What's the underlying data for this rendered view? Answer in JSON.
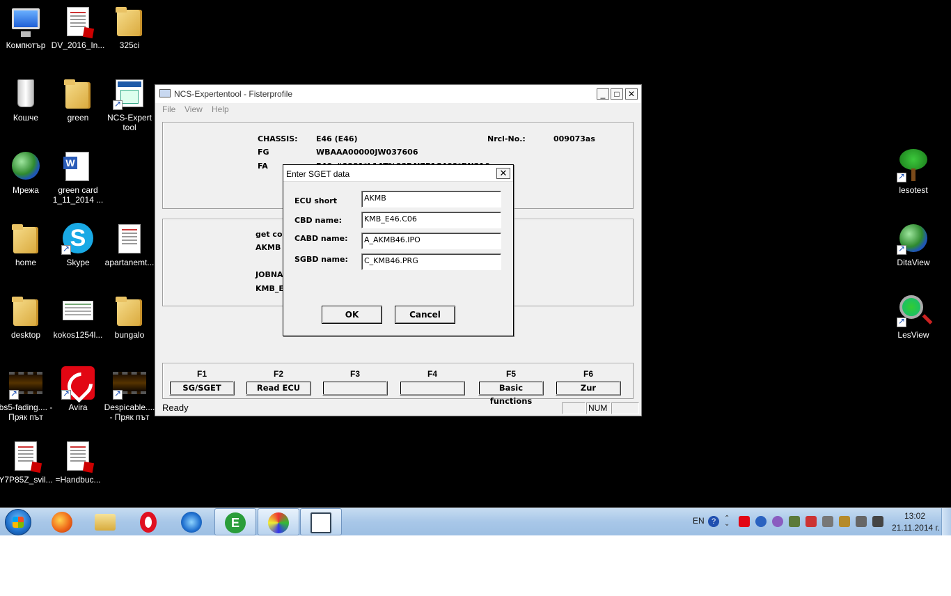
{
  "desktop": {
    "left_icons": [
      {
        "label": "Компютър"
      },
      {
        "label": "DV_2016_In..."
      },
      {
        "label": "325ci"
      },
      {
        "label": "Кошче"
      },
      {
        "label": "green"
      },
      {
        "label": "NCS-Expert tool"
      },
      {
        "label": "Мрежа"
      },
      {
        "label": "green card 1_11_2014 ..."
      },
      {
        "label": "home"
      },
      {
        "label": "Skype"
      },
      {
        "label": "apartanemt..."
      },
      {
        "label": "desktop"
      },
      {
        "label": "kokos1254l..."
      },
      {
        "label": "bungalo"
      },
      {
        "label": "bs5-fading.... - Пряк път"
      },
      {
        "label": "Avira"
      },
      {
        "label": "Despicable.... - Пряк път"
      },
      {
        "label": "Y7P85Z_svil..."
      },
      {
        "label": "=Handbuc..."
      }
    ],
    "right_icons": [
      {
        "label": "lesotest"
      },
      {
        "label": "DitaView"
      },
      {
        "label": "LesView"
      }
    ]
  },
  "ncs_window": {
    "title": "NCS-Expertentool - Fisterprofile",
    "menu": [
      "File",
      "View",
      "Help"
    ],
    "info": {
      "chassis_label": "CHASSIS:",
      "chassis_value": "E46 (E46)",
      "nrcl_label": "Nrcl-No.:",
      "nrcl_value": "009073as",
      "fg_label": "FG",
      "fg_value": "WBAAA00000JW037606",
      "fa_label": "FA",
      "fa_value": "E46_#0901*L1AT%03E4I7E1C460*BN31&"
    },
    "job": {
      "line1": "get coc",
      "line2": "AKMB",
      "line3": "JOBNA",
      "line4": "KMB_E"
    },
    "fkeys": [
      {
        "key": "F1",
        "label": "SG/SGET"
      },
      {
        "key": "F2",
        "label": "Read ECU"
      },
      {
        "key": "F3",
        "label": ""
      },
      {
        "key": "F4",
        "label": ""
      },
      {
        "key": "F5",
        "label": "Basic functions"
      },
      {
        "key": "F6",
        "label": "Zur"
      }
    ],
    "status": {
      "text": "Ready",
      "cell2": "",
      "num": "NUM",
      "cell4": ""
    }
  },
  "dialog": {
    "title": "Enter SGET data",
    "fields": [
      {
        "label": "ECU short",
        "value": "AKMB"
      },
      {
        "label": "CBD name:",
        "value": "KMB_E46.C06"
      },
      {
        "label": "CABD name:",
        "value": "A_AKMB46.IPO"
      },
      {
        "label": "SGBD name:",
        "value": "C_KMB46.PRG"
      }
    ],
    "ok_label": "OK",
    "cancel_label": "Cancel"
  },
  "taskbar": {
    "language": "EN",
    "time": "13:02",
    "date": "21.11.2014 г."
  }
}
